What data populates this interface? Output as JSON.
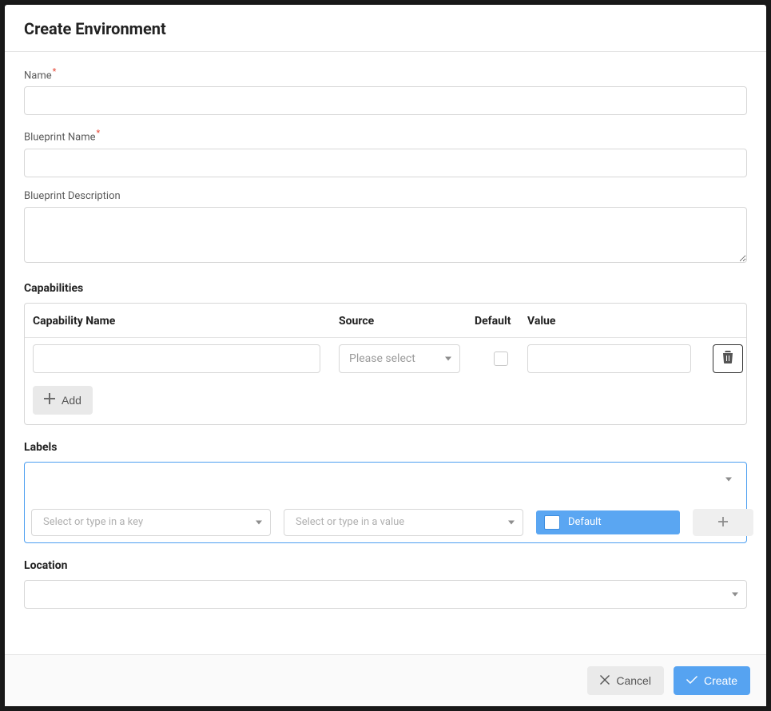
{
  "modal": {
    "title": "Create Environment"
  },
  "form": {
    "name": {
      "label": "Name",
      "required_marker": "*",
      "value": ""
    },
    "blueprint_name": {
      "label": "Blueprint Name",
      "required_marker": "*",
      "value": ""
    },
    "blueprint_description": {
      "label": "Blueprint Description",
      "value": ""
    }
  },
  "capabilities": {
    "heading": "Capabilities",
    "columns": {
      "name": "Capability Name",
      "source": "Source",
      "default": "Default",
      "value": "Value"
    },
    "rows": [
      {
        "name": "",
        "source_placeholder": "Please select",
        "default_checked": false,
        "value": ""
      }
    ],
    "add_label": "Add"
  },
  "labels": {
    "heading": "Labels",
    "key_placeholder": "Select or type in a key",
    "value_placeholder": "Select or type in a value",
    "default_pill": "Default"
  },
  "location": {
    "heading": "Location",
    "value": ""
  },
  "footer": {
    "cancel": "Cancel",
    "create": "Create"
  }
}
